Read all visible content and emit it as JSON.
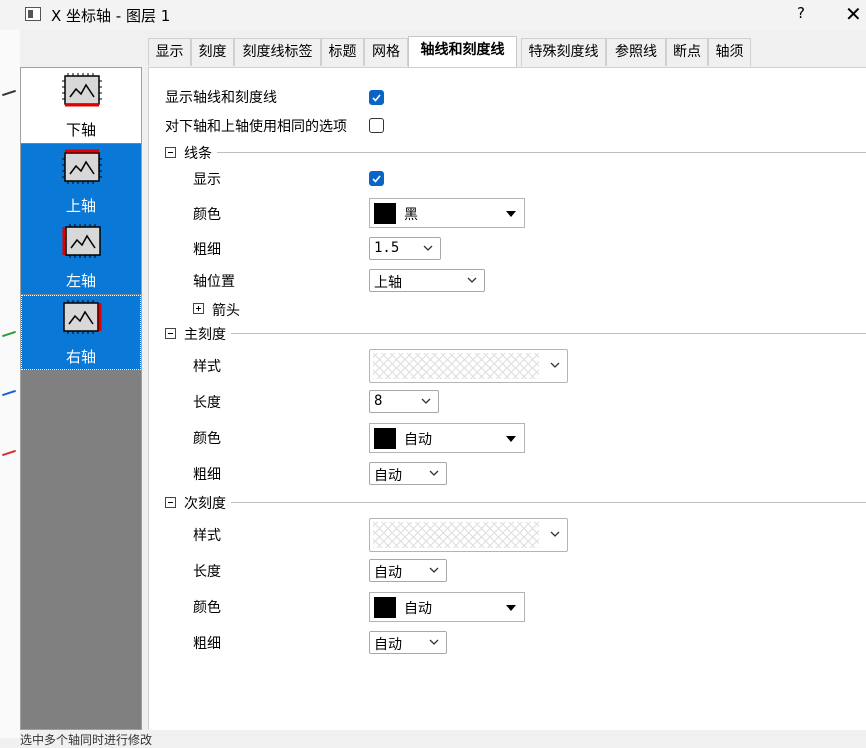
{
  "window": {
    "title": "X 坐标轴 - 图层 1",
    "help": "?",
    "close": "✕"
  },
  "axes": [
    {
      "label": "下轴",
      "state": "selected"
    },
    {
      "label": "上轴",
      "state": "active"
    },
    {
      "label": "左轴",
      "state": "active"
    },
    {
      "label": "右轴",
      "state": "active"
    }
  ],
  "tabs": [
    "显示",
    "刻度",
    "刻度线标签",
    "标题",
    "网格",
    "轴线和刻度线",
    "特殊刻度线",
    "参照线",
    "断点",
    "轴须"
  ],
  "current_tab": "轴线和刻度线",
  "options": {
    "show_axes_ticks": {
      "label": "显示轴线和刻度线",
      "checked": true
    },
    "same_options": {
      "label": "对下轴和上轴使用相同的选项",
      "checked": false
    }
  },
  "line": {
    "header": "线条",
    "show_label": "显示",
    "show_checked": true,
    "color_label": "颜色",
    "color_value": "黑",
    "width_label": "粗细",
    "width_value": "1.5",
    "position_label": "轴位置",
    "position_value": "上轴",
    "arrow_label": "箭头"
  },
  "major": {
    "header": "主刻度",
    "style_label": "样式",
    "length_label": "长度",
    "length_value": "8",
    "color_label": "颜色",
    "color_value": "自动",
    "width_label": "粗细",
    "width_value": "自动"
  },
  "minor": {
    "header": "次刻度",
    "style_label": "样式",
    "length_label": "长度",
    "length_value": "自动",
    "color_label": "颜色",
    "color_value": "自动",
    "width_label": "粗细",
    "width_value": "自动"
  },
  "status": "选中多个轴同时进行修改",
  "colors": {
    "accent": "#0a78d7",
    "check": "#0a64c8",
    "list_bg": "#808080"
  }
}
